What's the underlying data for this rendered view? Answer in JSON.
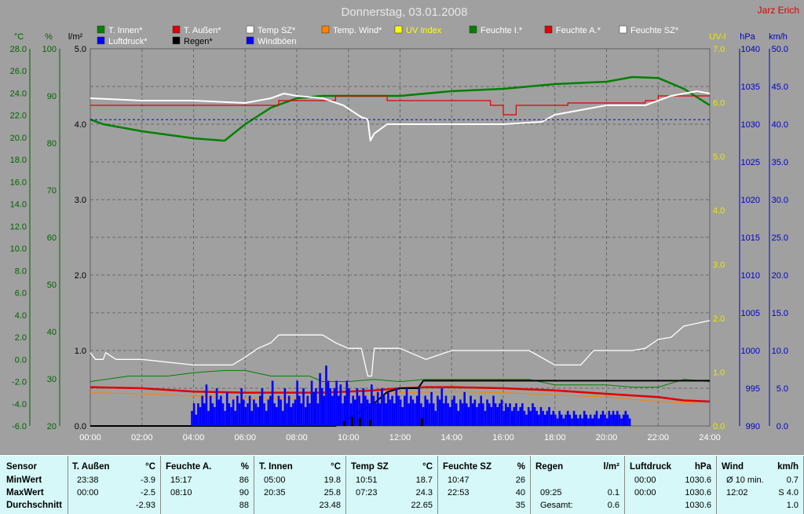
{
  "title": "Donnerstag, 03.01.2008",
  "author": "Jarz Erich",
  "legend_row1": [
    {
      "label": "T. Innen*",
      "color": "#008000",
      "text_color": "#ffffff"
    },
    {
      "label": "T. Außen*",
      "color": "#e00000",
      "text_color": "#ffffff"
    },
    {
      "label": "Temp SZ*",
      "color": "#ffffff",
      "text_color": "#ffffff"
    },
    {
      "label": "Temp. Wind*",
      "color": "#ff8000",
      "text_color": "#ffffff"
    },
    {
      "label": "UV Index",
      "color": "#ffff00",
      "text_color": "#ffff00"
    },
    {
      "label": "Feuchte I.*",
      "color": "#008000",
      "text_color": "#ffffff"
    },
    {
      "label": "Feuchte A.*",
      "color": "#e00000",
      "text_color": "#ffffff"
    },
    {
      "label": "Feuchte SZ*",
      "color": "#ffffff",
      "text_color": "#ffffff"
    }
  ],
  "legend_row2": [
    {
      "label": "Luftdruck*",
      "color": "#0000ff",
      "text_color": "#ffffff"
    },
    {
      "label": "Regen*",
      "color": "#000000",
      "text_color": "#000000"
    },
    {
      "label": "Windböen",
      "color": "#0000ff",
      "text_color": "#ffffff"
    }
  ],
  "axis_units": {
    "celsius": "°C",
    "percent": "%",
    "rain": "l/m²",
    "uv": "UV-I",
    "pressure": "hPa",
    "wind": "km/h"
  },
  "axis_ticks": {
    "celsius": [
      "28.0",
      "26.0",
      "24.0",
      "22.0",
      "20.0",
      "18.0",
      "16.0",
      "14.0",
      "12.0",
      "10.0",
      "8.0",
      "6.0",
      "4.0",
      "2.0",
      "0.0",
      "-2.0",
      "-4.0",
      "-6.0"
    ],
    "percent": [
      "100",
      "90",
      "80",
      "70",
      "60",
      "50",
      "40",
      "30",
      "20"
    ],
    "rain": [
      "5.0",
      "4.0",
      "3.0",
      "2.0",
      "1.0",
      "0.0"
    ],
    "uv": [
      "7.0",
      "6.0",
      "5.0",
      "4.0",
      "3.0",
      "2.0",
      "1.0",
      "0.0"
    ],
    "pressure": [
      "1040",
      "1035",
      "1030",
      "1025",
      "1020",
      "1015",
      "1010",
      "1005",
      "1000",
      "995",
      "990"
    ],
    "wind": [
      "50.0",
      "45.0",
      "40.0",
      "35.0",
      "30.0",
      "25.0",
      "20.0",
      "15.0",
      "10.0",
      "5.0",
      "0.0"
    ]
  },
  "chart_data": {
    "type": "line",
    "title": "Donnerstag, 03.01.2008",
    "x_ticks": [
      "00:00",
      "02:00",
      "04:00",
      "06:00",
      "08:00",
      "10:00",
      "12:00",
      "14:00",
      "16:00",
      "18:00",
      "20:00",
      "22:00",
      "24:00"
    ],
    "x_range_hours": [
      0,
      24
    ],
    "axes": {
      "celsius": [
        -6,
        28
      ],
      "percent": [
        20,
        100
      ],
      "rain": [
        0,
        5
      ],
      "uv": [
        0,
        7
      ],
      "pressure": [
        990,
        1040
      ],
      "wind": [
        0,
        50
      ]
    },
    "grid": true,
    "series": [
      {
        "name": "Feuchte I.",
        "axis": "percent",
        "color": "#008000",
        "width": 2.5,
        "points": [
          [
            0,
            85
          ],
          [
            0.5,
            84
          ],
          [
            2,
            82.5
          ],
          [
            4,
            81
          ],
          [
            5.2,
            80.5
          ],
          [
            6,
            84
          ],
          [
            7,
            87.5
          ],
          [
            8,
            89.5
          ],
          [
            9,
            90
          ],
          [
            10,
            90
          ],
          [
            12,
            90
          ],
          [
            14,
            91
          ],
          [
            16,
            91.5
          ],
          [
            18,
            92.5
          ],
          [
            20,
            93
          ],
          [
            21,
            94
          ],
          [
            22,
            93.8
          ],
          [
            23,
            91.5
          ],
          [
            24,
            88
          ]
        ]
      },
      {
        "name": "Feuchte A.",
        "axis": "percent",
        "color": "#e00000",
        "width": 1.2,
        "points": [
          [
            0,
            88
          ],
          [
            7.3,
            88
          ],
          [
            7.3,
            89
          ],
          [
            9.5,
            89
          ],
          [
            9.5,
            90
          ],
          [
            11.5,
            90
          ],
          [
            11.5,
            89
          ],
          [
            15.5,
            89
          ],
          [
            15.5,
            88
          ],
          [
            16,
            88
          ],
          [
            16,
            86
          ],
          [
            16.5,
            86
          ],
          [
            16.5,
            88
          ],
          [
            18.5,
            88
          ],
          [
            18.5,
            88.5
          ],
          [
            21.5,
            88.5
          ],
          [
            21.5,
            89
          ],
          [
            22,
            89
          ],
          [
            22,
            90
          ],
          [
            24,
            90
          ]
        ]
      },
      {
        "name": "Feuchte SZ",
        "axis": "percent",
        "color": "#ffffff",
        "width": 2,
        "points": [
          [
            0,
            89.5
          ],
          [
            2,
            89
          ],
          [
            4,
            89
          ],
          [
            6,
            88.5
          ],
          [
            7,
            89.5
          ],
          [
            7.5,
            90.5
          ],
          [
            8,
            90
          ],
          [
            9,
            89.5
          ],
          [
            9.8,
            88
          ],
          [
            10.5,
            85.5
          ],
          [
            10.75,
            85
          ],
          [
            10.85,
            80.5
          ],
          [
            11,
            82
          ],
          [
            11.5,
            84
          ],
          [
            12,
            84
          ],
          [
            13,
            84
          ],
          [
            14,
            84
          ],
          [
            16,
            84
          ],
          [
            17.5,
            84.5
          ],
          [
            18,
            86
          ],
          [
            19,
            87
          ],
          [
            20,
            88
          ],
          [
            21.5,
            88
          ],
          [
            22.5,
            90
          ],
          [
            23.5,
            91
          ],
          [
            24,
            90.5
          ]
        ]
      },
      {
        "name": "Luftdruck",
        "axis": "pressure",
        "color": "#0000ff",
        "width": 1,
        "dashed": true,
        "points": [
          [
            0,
            1030.6
          ],
          [
            24,
            1030.6
          ]
        ]
      },
      {
        "name": "Temp SZ",
        "axis": "celsius",
        "color": "#ffffff",
        "width": 1.3,
        "points": [
          [
            0,
            0.6
          ],
          [
            0.2,
            0
          ],
          [
            0.5,
            0
          ],
          [
            0.6,
            0.6
          ],
          [
            1,
            0
          ],
          [
            2,
            0
          ],
          [
            4,
            -0.5
          ],
          [
            5.5,
            -0.5
          ],
          [
            6,
            0.2
          ],
          [
            6.5,
            1
          ],
          [
            7,
            1.5
          ],
          [
            7.3,
            2.2
          ],
          [
            8,
            2.2
          ],
          [
            9,
            2.2
          ],
          [
            9.5,
            1.5
          ],
          [
            10,
            1
          ],
          [
            10.5,
            1
          ],
          [
            10.75,
            -1.5
          ],
          [
            10.9,
            -1.5
          ],
          [
            11,
            1
          ],
          [
            11.5,
            1
          ],
          [
            12,
            1
          ],
          [
            13,
            0
          ],
          [
            14,
            0.8
          ],
          [
            15,
            0.8
          ],
          [
            16,
            0.8
          ],
          [
            17,
            0.8
          ],
          [
            18,
            -0.5
          ],
          [
            19,
            -0.5
          ],
          [
            19.5,
            0.8
          ],
          [
            21,
            0.8
          ],
          [
            21.5,
            1
          ],
          [
            22,
            1.8
          ],
          [
            22.5,
            2
          ],
          [
            23,
            3
          ],
          [
            24,
            3.5
          ]
        ]
      },
      {
        "name": "T. Innen",
        "axis": "celsius",
        "color": "#008000",
        "width": 1,
        "points": [
          [
            0,
            -2
          ],
          [
            1.5,
            -1.5
          ],
          [
            3,
            -1.5
          ],
          [
            4,
            -1.2
          ],
          [
            5.2,
            -1
          ],
          [
            6,
            -1
          ],
          [
            7,
            -1.5
          ],
          [
            8.5,
            -1.5
          ],
          [
            9,
            -2
          ],
          [
            10,
            -2
          ],
          [
            11,
            -1.8
          ],
          [
            12,
            -2
          ],
          [
            13,
            -1.8
          ],
          [
            15,
            -1.8
          ],
          [
            17,
            -1.8
          ],
          [
            18,
            -2.3
          ],
          [
            20,
            -2.3
          ],
          [
            21,
            -2.5
          ],
          [
            22,
            -2.5
          ],
          [
            23,
            -1.8
          ],
          [
            24,
            -2
          ]
        ]
      },
      {
        "name": "T. Außen",
        "axis": "celsius",
        "color": "#e00000",
        "width": 2.5,
        "points": [
          [
            0,
            -2.5
          ],
          [
            2,
            -2.6
          ],
          [
            4,
            -2.9
          ],
          [
            6,
            -3.0
          ],
          [
            8,
            -3.0
          ],
          [
            9,
            -3.0
          ],
          [
            10,
            -2.9
          ],
          [
            11,
            -2.8
          ],
          [
            12,
            -2.6
          ],
          [
            13,
            -2.5
          ],
          [
            14,
            -2.5
          ],
          [
            16,
            -2.6
          ],
          [
            18,
            -2.8
          ],
          [
            20,
            -3.1
          ],
          [
            22,
            -3.4
          ],
          [
            23,
            -3.7
          ],
          [
            24,
            -3.8
          ]
        ]
      },
      {
        "name": "Temp. Wind",
        "axis": "celsius",
        "color": "#ff8000",
        "width": 1,
        "points": [
          [
            0,
            -3
          ],
          [
            2,
            -3.1
          ],
          [
            4,
            -3.3
          ],
          [
            6,
            -3.5
          ],
          [
            8,
            -3.5
          ],
          [
            10,
            -3.3
          ],
          [
            12,
            -3.0
          ],
          [
            14,
            -2.9
          ],
          [
            16,
            -3.0
          ],
          [
            18,
            -3.2
          ],
          [
            20,
            -3.4
          ],
          [
            22,
            -3.8
          ],
          [
            24,
            -4.0
          ]
        ]
      },
      {
        "name": "Regen",
        "axis": "rain",
        "color": "#000000",
        "width": 2,
        "points": [
          [
            0,
            0
          ],
          [
            9.5,
            0
          ],
          [
            10,
            0.1
          ],
          [
            10.5,
            0.2
          ],
          [
            11,
            0.3
          ],
          [
            11.5,
            0.45
          ],
          [
            12,
            0.5
          ],
          [
            12.7,
            0.5
          ],
          [
            12.9,
            0.6
          ],
          [
            24,
            0.6
          ]
        ]
      }
    ],
    "wind_bars": {
      "axis": "wind",
      "color": "#0000ff",
      "start_hour": 3.9,
      "end_hour": 24,
      "step_hours": 0.08,
      "heights": [
        2,
        3,
        1.5,
        3,
        2.5,
        4,
        3,
        5.5,
        2,
        4,
        3,
        2.5,
        5,
        3.5,
        4,
        3,
        2,
        4.5,
        3,
        2.5,
        3.5,
        2,
        4,
        3,
        5,
        3.5,
        2.5,
        3,
        4,
        2,
        3.5,
        3,
        2.5,
        4,
        5,
        3,
        2,
        3.5,
        4,
        6,
        3,
        2.5,
        4,
        3.5,
        2,
        5,
        3,
        4,
        2.5,
        3,
        3.5,
        6,
        4,
        3,
        5,
        2.5,
        4,
        3,
        6,
        4.5,
        5,
        3,
        7,
        5,
        4,
        8,
        6,
        5,
        4,
        5,
        6,
        4,
        5.5,
        3,
        4,
        6,
        5,
        3,
        4,
        3.5,
        5,
        4,
        3,
        5,
        4,
        3.5,
        3,
        5.5,
        4,
        3,
        4.5,
        3,
        5,
        4,
        3,
        4.5,
        3.5,
        4,
        3,
        5,
        4,
        3.5,
        2.5,
        4,
        5,
        3,
        4,
        3.5,
        3,
        4,
        5,
        3,
        2.5,
        4,
        3.5,
        3,
        4.5,
        3,
        2,
        4,
        3.5,
        5,
        3,
        4,
        3,
        2.5,
        3.5,
        4,
        3,
        2,
        3.5,
        3,
        4.5,
        3,
        2.5,
        4,
        3,
        3.5,
        2.5,
        3,
        4,
        3,
        2,
        3.5,
        3,
        2.5,
        4,
        3,
        2.5,
        3,
        3.5,
        2,
        3,
        2.5,
        3,
        2,
        2.5,
        3,
        2,
        2.5,
        3,
        2,
        1.5,
        2.5,
        2,
        3,
        2.5,
        2,
        1.5,
        2.5,
        2,
        1.5,
        2,
        2.5,
        1.5,
        2,
        1.5,
        1,
        2,
        1.5,
        1,
        1.5,
        2,
        1.5,
        1,
        2,
        1.5,
        1,
        1.5,
        1,
        2,
        1.5,
        1,
        1.5,
        1,
        1.5,
        2,
        1,
        1.5,
        2,
        1.5,
        1,
        2,
        1.5,
        2,
        1.5,
        2,
        1.5,
        1,
        1.5,
        2,
        1.5,
        1
      ]
    },
    "rain_bars": {
      "axis": "rain",
      "color": "#000000",
      "bars": [
        [
          9.8,
          0.06
        ],
        [
          10.1,
          0.12
        ],
        [
          10.4,
          0.1
        ],
        [
          10.8,
          0.08
        ],
        [
          12.8,
          0.1
        ]
      ]
    }
  },
  "table": {
    "row_labels": [
      "Sensor",
      "MinWert",
      "MaxWert",
      "Durchschnitt"
    ],
    "columns": [
      {
        "title": "T. Außen",
        "unit": "°C",
        "rows": [
          [
            "23:38",
            "-3.9"
          ],
          [
            "00:00",
            "-2.5"
          ],
          [
            "",
            "-2.93"
          ]
        ]
      },
      {
        "title": "Feuchte A.",
        "unit": "%",
        "rows": [
          [
            "15:17",
            "86"
          ],
          [
            "08:10",
            "90"
          ],
          [
            "",
            "88"
          ]
        ]
      },
      {
        "title": "T. Innen",
        "unit": "°C",
        "rows": [
          [
            "05:00",
            "19.8"
          ],
          [
            "20:35",
            "25.8"
          ],
          [
            "",
            "23.48"
          ]
        ]
      },
      {
        "title": "Temp SZ",
        "unit": "°C",
        "rows": [
          [
            "10:51",
            "18.7"
          ],
          [
            "07:23",
            "24.3"
          ],
          [
            "",
            "22.65"
          ]
        ]
      },
      {
        "title": "Feuchte SZ",
        "unit": "%",
        "rows": [
          [
            "10:47",
            "26"
          ],
          [
            "22:53",
            "40"
          ],
          [
            "",
            "35"
          ]
        ]
      },
      {
        "title": "Regen",
        "unit": "l/m²",
        "rows": [
          [
            "",
            ""
          ],
          [
            "09:25",
            "0.1"
          ],
          [
            "Gesamt:",
            "0.6"
          ]
        ]
      },
      {
        "title": "Luftdruck",
        "unit": "hPa",
        "rows": [
          [
            "00:00",
            "1030.6"
          ],
          [
            "00:00",
            "1030.6"
          ],
          [
            "",
            "1030.6"
          ]
        ]
      },
      {
        "title": "Wind",
        "unit": "km/h",
        "rows": [
          [
            "Ø 10 min.",
            "0.7"
          ],
          [
            "12:02",
            "S 4.0"
          ],
          [
            "",
            "1.0"
          ]
        ]
      }
    ]
  }
}
